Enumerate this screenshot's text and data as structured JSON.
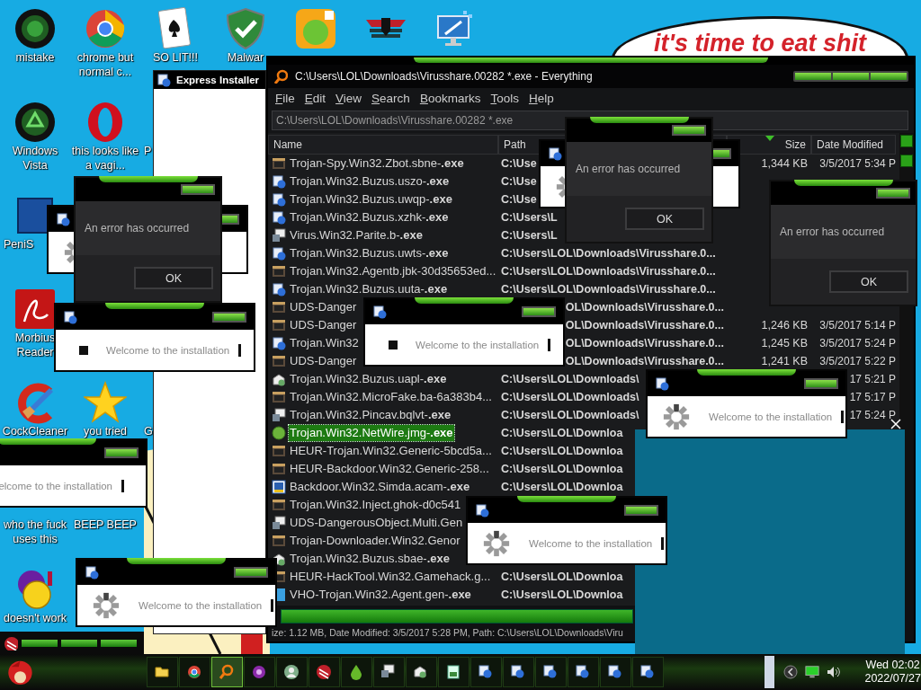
{
  "desktop": {
    "icons": [
      {
        "label": "mistake",
        "kind": "disc"
      },
      {
        "label": "Windows Vista",
        "kind": "recycle"
      },
      {
        "label": "PeniS",
        "kind": "tile",
        "label_cut": true
      },
      {
        "label": "Morbius Reader",
        "kind": "swirl"
      },
      {
        "label": "CockCleaner",
        "kind": "brush"
      },
      {
        "label": "who the fuck uses this"
      },
      {
        "label": "doesn't work",
        "kind": "ball"
      },
      {
        "label": "chrome but normal c...",
        "kind": "wheel"
      },
      {
        "label": "this looks like a vagi...",
        "kind": "ring"
      },
      {
        "label": "you tried",
        "kind": "star"
      },
      {
        "label": "BEEP BEEP"
      },
      {
        "label": "SO LIT!!!",
        "kind": "card"
      },
      {
        "label": "P",
        "label_cut": true
      },
      {
        "label": "G",
        "label_cut": true
      },
      {
        "label": "Malwar",
        "kind": "shield"
      },
      {
        "kind": "apptile"
      },
      {
        "kind": "emblem"
      },
      {
        "kind": "monitor"
      }
    ],
    "speech_bubble": "it's time to eat shit"
  },
  "express_installer": {
    "title": "Express Installer"
  },
  "everything": {
    "title": "C:\\Users\\LOL\\Downloads\\Virusshare.00282 *.exe - Everything",
    "menu": [
      "File",
      "Edit",
      "View",
      "Search",
      "Bookmarks",
      "Tools",
      "Help"
    ],
    "search": "C:\\Users\\LOL\\Downloads\\Virusshare.00282 *.exe",
    "columns": [
      {
        "label": "Name",
        "sorted": false
      },
      {
        "label": "Path",
        "sorted": false
      },
      {
        "label": "Size",
        "sorted": true
      },
      {
        "label": "Date Modified",
        "sorted": false
      }
    ],
    "rows": [
      {
        "kind": "clapper",
        "name": "Trojan-Spy.Win32.Zbot.sbne-**.exe**",
        "path": "C:\\Use",
        "size": "1,344 KB",
        "date": "3/5/2017 5:34 P",
        "path_cut_left": false,
        "selected": false
      },
      {
        "kind": "installer",
        "name": "Trojan.Win32.Buzus.uszo-**.exe**",
        "path": "C:\\Use",
        "path_cut_left": false,
        "selected": false
      },
      {
        "kind": "installer",
        "name": "Trojan.Win32.Buzus.uwqp-**.exe**",
        "path": "C:\\Use",
        "path_cut_left": false,
        "selected": false
      },
      {
        "kind": "installer",
        "name": "Trojan.Win32.Buzus.xzhk-**.exe**",
        "path": "C:\\Users\\L",
        "path_cut_left": false,
        "selected": false
      },
      {
        "kind": "window",
        "name": "Virus.Win32.Parite.b-**.exe**",
        "path": "C:\\Users\\L",
        "path_cut_left": false,
        "selected": false
      },
      {
        "kind": "installer",
        "name": "Trojan.Win32.Buzus.uwts-**.exe**",
        "path": "C:\\Users\\LOL\\Downloads\\Virusshare.0...",
        "path_cut_left": false,
        "selected": false
      },
      {
        "kind": "clapper",
        "name": "Trojan.Win32.Agentb.jbk-30d35653ed...",
        "path": "C:\\Users\\LOL\\Downloads\\Virusshare.0...",
        "path_cut_left": false,
        "selected": false
      },
      {
        "kind": "installer",
        "name": "Trojan.Win32.Buzus.uuta-**.exe**",
        "path": "C:\\Users\\LOL\\Downloads\\Virusshare.0...",
        "path_cut_left": false,
        "selected": false
      },
      {
        "kind": "clapper",
        "name": "UDS-Danger",
        "path": "OL\\Downloads\\Virusshare.0...",
        "path_cut_left": true,
        "selected": false
      },
      {
        "kind": "clapper",
        "name": "UDS-Danger",
        "path": "OL\\Downloads\\Virusshare.0...",
        "size": "1,246 KB",
        "date": "3/5/2017 5:14 P",
        "path_cut_left": true,
        "selected": false
      },
      {
        "kind": "installer",
        "name": "Trojan.Win32",
        "path": "OL\\Downloads\\Virusshare.0...",
        "size": "1,245 KB",
        "date": "3/5/2017 5:24 P",
        "path_cut_left": true,
        "selected": false
      },
      {
        "kind": "clapper",
        "name": "UDS-Danger",
        "path": "OL\\Downloads\\Virusshare.0...",
        "size": "1,241 KB",
        "date": "3/5/2017 5:22 P",
        "path_cut_left": true,
        "selected": false
      },
      {
        "kind": "box",
        "name": "Trojan.Win32.Buzus.uapl-**.exe**",
        "path": "C:\\Users\\LOL\\Downloads\\",
        "date": "17 5:21 P",
        "path_cut_left": false,
        "selected": false
      },
      {
        "kind": "clapper",
        "name": "Trojan.Win32.MicroFake.ba-6a383b4...",
        "path": "C:\\Users\\LOL\\Downloads\\",
        "date": "17 5:17 P",
        "path_cut_left": false,
        "selected": false
      },
      {
        "kind": "window",
        "name": "Trojan.Win32.Pincav.bqlvt-**.exe**",
        "path": "C:\\Users\\LOL\\Downloads\\",
        "date": "17 5:24 P",
        "path_cut_left": false,
        "selected": false
      },
      {
        "kind": "globe",
        "name": "Trojan.Win32.NetWire.jmg-**.exe**",
        "path": "C:\\Users\\LOL\\Downloa",
        "path_cut_left": false,
        "selected": true
      },
      {
        "kind": "clapper",
        "name": "HEUR-Trojan.Win32.Generic-5bcd5a...",
        "path": "C:\\Users\\LOL\\Downloa",
        "path_cut_left": false,
        "selected": false
      },
      {
        "kind": "clapper",
        "name": "HEUR-Backdoor.Win32.Generic-258...",
        "path": "C:\\Users\\LOL\\Downloa",
        "path_cut_left": false,
        "selected": false
      },
      {
        "kind": "frame",
        "name": "Backdoor.Win32.Simda.acam-**.exe**",
        "path": "C:\\Users\\LOL\\Downloa",
        "path_cut_left": false,
        "selected": false
      },
      {
        "kind": "clapper",
        "name": "Trojan.Win32.Inject.ghok-d0c541",
        "selected": false
      },
      {
        "kind": "window",
        "name": "UDS-DangerousObject.Multi.Gen",
        "selected": false
      },
      {
        "kind": "clapper",
        "name": "Trojan-Downloader.Win32.Genor",
        "selected": false
      },
      {
        "kind": "box",
        "name": "Trojan.Win32.Buzus.sbae-**.exe**",
        "selected": false
      },
      {
        "kind": "clapper",
        "name": "HEUR-HackTool.Win32.Gamehack.g...",
        "path": "C:\\Users\\LOL\\Downloa",
        "path_cut_left": false,
        "selected": false
      },
      {
        "kind": "tile",
        "name": "VHO-Trojan.Win32.Agent.gen-**.exe**",
        "path": "C:\\Users\\LOL\\Downloa",
        "path_cut_left": false,
        "selected": false
      }
    ],
    "status_bar": "ize: 1.12 MB, Date Modified: 3/5/2017 5:28 PM, Path: C:\\Users\\LOL\\Downloads\\Viru"
  },
  "windows": [
    {
      "kind": "spinner"
    },
    {
      "kind": "error",
      "message": "An error has occurred",
      "button": "OK"
    },
    {
      "kind": "square",
      "text": "Welcome to the installation"
    },
    {
      "kind": "spinner"
    },
    {
      "kind": "error",
      "message": "An error has occurred",
      "button": "OK"
    },
    {
      "kind": "square",
      "text": "Welcome to the installation"
    },
    {
      "kind": "error",
      "message": "An error has occurred",
      "button": "OK"
    },
    {
      "kind": "panel"
    },
    {
      "kind": "spinner",
      "text": "Welcome to the installation"
    },
    {
      "kind": "welcome",
      "text": "elcome to the installation"
    },
    {
      "kind": "spinner",
      "text": "Welcome to the installation"
    },
    {
      "kind": "spinner",
      "text": "Welcome to the installation"
    },
    {
      "kind": "strip"
    }
  ],
  "taskbar": {
    "buttons": [
      {
        "kind": "folder",
        "active": false
      },
      {
        "kind": "wheel",
        "active": false
      },
      {
        "kind": "search",
        "active": true
      },
      {
        "kind": "disc",
        "active": false
      },
      {
        "kind": "user",
        "active": false
      },
      {
        "kind": "emblem",
        "active": false
      },
      {
        "kind": "drop",
        "active": false
      },
      {
        "kind": "window",
        "active": false
      },
      {
        "kind": "box",
        "active": false
      },
      {
        "kind": "document",
        "active": false
      },
      {
        "kind": "installer",
        "active": false
      },
      {
        "kind": "installer",
        "active": false
      },
      {
        "kind": "installer",
        "active": false
      },
      {
        "kind": "installer",
        "active": false
      },
      {
        "kind": "installer",
        "active": false
      },
      {
        "kind": "installer",
        "active": false
      }
    ],
    "clock": {
      "day_time": "Wed 02:02",
      "date": "2022/07/27"
    }
  }
}
